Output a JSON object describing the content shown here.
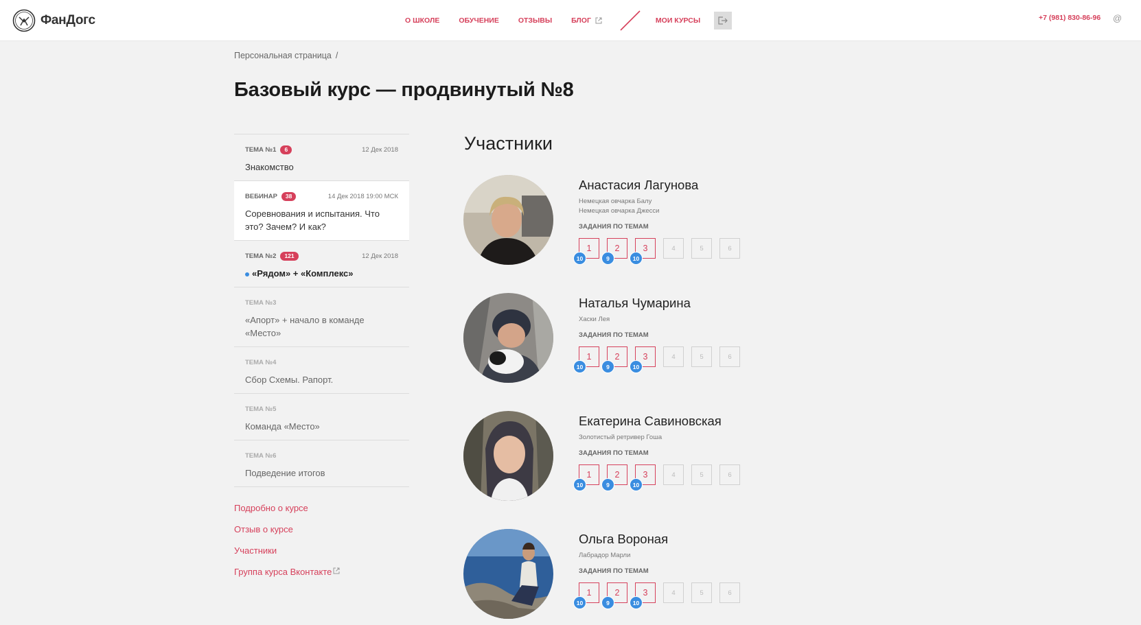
{
  "header": {
    "logo_text": "ФанДогс",
    "nav": [
      "О ШКОЛЕ",
      "ОБУЧЕНИЕ",
      "ОТЗЫВЫ",
      "БЛОГ"
    ],
    "my_courses": "МОИ КУРСЫ",
    "phone": "+7 (981) 830-86-96",
    "at": "@"
  },
  "breadcrumb": {
    "item": "Персональная страница",
    "sep": "/"
  },
  "page_title": "Базовый курс — продвинутый №8",
  "topics": [
    {
      "label": "ТЕМА №1",
      "badge": "6",
      "date": "12 Дек 2018",
      "title": "Знакомство"
    },
    {
      "label": "ВЕБИНАР",
      "badge": "38",
      "date": "14 Дек 2018 19:00 МСК",
      "title": "Соревнования и испытания. Что это? Зачем? И как?"
    },
    {
      "label": "ТЕМА №2",
      "badge": "121",
      "date": "12 Дек 2018",
      "title": "«Рядом» + «Комплекс»"
    },
    {
      "label": "ТЕМА №3",
      "title": "«Апорт» + начало в команде «Место»"
    },
    {
      "label": "ТЕМА №4",
      "title": "Сбор Схемы. Рапорт."
    },
    {
      "label": "ТЕМА №5",
      "title": "Команда «Место»"
    },
    {
      "label": "ТЕМА №6",
      "title": "Подведение итогов"
    }
  ],
  "side_links": [
    "Подробно о курсе",
    "Отзыв о курсе",
    "Участники",
    "Группа курса Вконтакте"
  ],
  "section_title": "Участники",
  "tasks_label": "ЗАДАНИЯ ПО ТЕМАМ",
  "task_numbers": [
    "1",
    "2",
    "3",
    "4",
    "5",
    "6"
  ],
  "participants": [
    {
      "name": "Анастасия Лагунова",
      "dogs": [
        "Немецкая овчарка Балу",
        "Немецкая овчарка Джесси"
      ],
      "scores": [
        "10",
        "9",
        "10"
      ]
    },
    {
      "name": "Наталья Чумарина",
      "dogs": [
        "Хаски Лея"
      ],
      "scores": [
        "10",
        "9",
        "10"
      ]
    },
    {
      "name": "Екатерина Савиновская",
      "dogs": [
        "Золотистый ретривер Гоша"
      ],
      "scores": [
        "10",
        "9",
        "10"
      ]
    },
    {
      "name": "Ольга Вороная",
      "dogs": [
        "Лабрадор Марли"
      ],
      "scores": [
        "10",
        "9",
        "10"
      ]
    }
  ],
  "colors": {
    "accent": "#d6405b",
    "score": "#3a8de0",
    "background": "#f2f2f2"
  }
}
